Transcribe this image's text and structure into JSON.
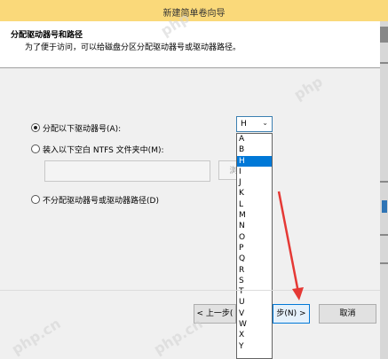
{
  "window": {
    "title": "新建简单卷向导"
  },
  "header": {
    "title": "分配驱动器号和路径",
    "subtitle": "为了便于访问，可以给磁盘分区分配驱动器号或驱动器路径。"
  },
  "options": {
    "assign_letter": "分配以下驱动器号(A):",
    "mount_folder": "装入以下空白 NTFS 文件夹中(M):",
    "no_assign": "不分配驱动器号或驱动器路径(D)"
  },
  "path": {
    "browse_label": "浏"
  },
  "drive_select": {
    "value": "H",
    "options": [
      "A",
      "B",
      "H",
      "I",
      "J",
      "K",
      "L",
      "M",
      "N",
      "O",
      "P",
      "Q",
      "R",
      "S",
      "T",
      "U",
      "V",
      "W",
      "X",
      "Y"
    ],
    "selected_index": 2
  },
  "buttons": {
    "back": "< 上一步(",
    "next": "步(N) >",
    "cancel": "取消"
  },
  "watermarks": [
    "php",
    "php.cn"
  ],
  "annotation_color": "#e53935"
}
